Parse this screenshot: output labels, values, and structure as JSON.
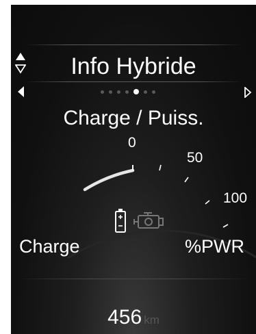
{
  "header": {
    "title": "Info Hybride",
    "nav_up_down_icon": "up-down-arrows-icon",
    "nav_left_icon": "left-arrow-icon",
    "nav_right_icon": "right-arrow-icon"
  },
  "pager": {
    "total_pages": 7,
    "active_page": 5
  },
  "gauge": {
    "title": "Charge / Puiss.",
    "scale_labels": [
      "0",
      "50",
      "100"
    ],
    "left_label": "Charge",
    "right_label": "%PWR",
    "charge_level": 0.75,
    "power_level": 0,
    "icons": [
      "battery-icon",
      "engine-icon"
    ],
    "colors": {
      "arc_fill": "#e8e8e8",
      "arc_track": "#3a3a3a",
      "ticks": "#ffffff"
    }
  },
  "odometer": {
    "value": "456",
    "unit": "km"
  }
}
